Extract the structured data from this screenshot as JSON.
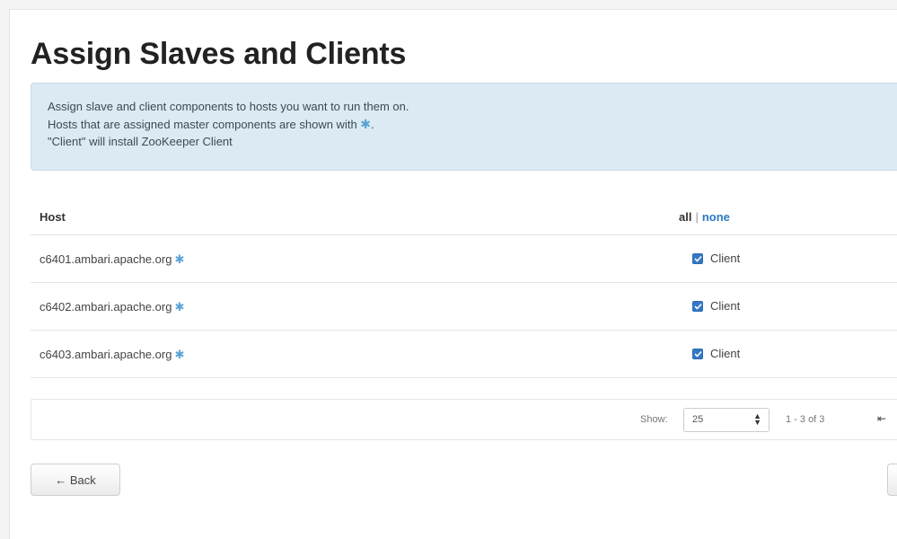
{
  "page": {
    "title": "Assign Slaves and Clients"
  },
  "info": {
    "line1": "Assign slave and client components to hosts you want to run them on.",
    "line2_prefix": "Hosts that are assigned master components are shown with ",
    "star": "✱",
    "line2_suffix": ".",
    "line3": "\"Client\" will install ZooKeeper Client"
  },
  "table": {
    "host_header": "Host",
    "all_label": "all",
    "separator": "|",
    "none_label": "none",
    "rows": [
      {
        "host": "c6401.ambari.apache.org",
        "client_label": "Client",
        "checked": true
      },
      {
        "host": "c6402.ambari.apache.org",
        "client_label": "Client",
        "checked": true
      },
      {
        "host": "c6403.ambari.apache.org",
        "client_label": "Client",
        "checked": true
      }
    ]
  },
  "pager": {
    "show_label": "Show:",
    "page_size": "25",
    "range": "1 - 3 of 3",
    "first_icon": "⇤"
  },
  "buttons": {
    "back_label": "← Back"
  },
  "colors": {
    "accent": "#2a7ac0",
    "info_bg": "#dcebf3",
    "checkbox": "#3478c6"
  }
}
